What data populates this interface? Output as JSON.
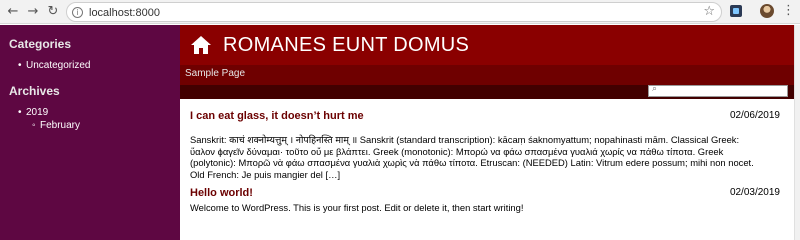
{
  "browser": {
    "back_icon": "arrow-left-icon",
    "forward_icon": "arrow-right-icon",
    "reload_icon": "reload-icon",
    "url": "localhost:8000"
  },
  "sidebar": {
    "categories_title": "Categories",
    "categories": [
      "Uncategorized"
    ],
    "archives_title": "Archives",
    "archive_year": "2019",
    "archive_month": "February"
  },
  "header": {
    "site_title": "ROMANES EUNT DOMUS",
    "menu_item": "Sample Page"
  },
  "posts": [
    {
      "title": "I can eat glass, it doesn’t hurt me",
      "date": "02/06/2019",
      "excerpt": "Sanskrit: काचं शक्नोम्यत्तुम् । नोपहिनस्ति माम् ॥ Sanskrit (standard transcription): kācaṃ śaknomyattum; nopahinasti mām. Classical Greek: ὕαλον ϕαγεῖν δύναμαι· τοῦτο οὔ με βλάπτει. Greek (monotonic): Μπορώ να φάω σπασμένα γυαλιά χωρίς να πάθω τίποτα. Greek (polytonic): Μπορῶ νὰ φάω σπασμένα γυαλιὰ χωρὶς νὰ πάθω τίποτα. Etruscan: (NEEDED) Latin: Vitrum edere possum; mihi non nocet. Old French: Je puis mangier del […]"
    },
    {
      "title": "Hello world!",
      "date": "02/03/2019",
      "excerpt": "Welcome to WordPress. This is your first post. Edit or delete it, then start writing!"
    }
  ],
  "colors": {
    "sidebar_bg": "#5e0742",
    "header_bg": "#8a0000",
    "menubar_bg": "#6f0000",
    "searchbar_bg": "#420000",
    "post_title": "#6b0000"
  }
}
